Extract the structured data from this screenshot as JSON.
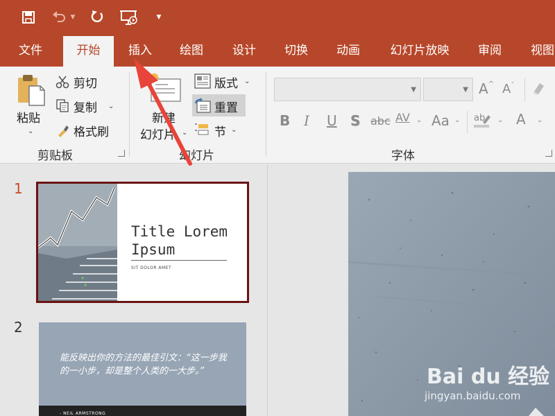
{
  "quick_access": {
    "icons": [
      "save-icon",
      "undo-icon",
      "dropdown-icon",
      "redo-icon",
      "slideshow-icon",
      "customize-icon"
    ]
  },
  "tabs": [
    {
      "label": "文件",
      "active": false
    },
    {
      "label": "开始",
      "active": true
    },
    {
      "label": "插入",
      "active": false
    },
    {
      "label": "绘图",
      "active": false
    },
    {
      "label": "设计",
      "active": false
    },
    {
      "label": "切换",
      "active": false
    },
    {
      "label": "动画",
      "active": false
    },
    {
      "label": "幻灯片放映",
      "active": false
    },
    {
      "label": "审阅",
      "active": false
    },
    {
      "label": "视图",
      "active": false
    }
  ],
  "ribbon": {
    "clipboard": {
      "paste": "粘贴",
      "cut": "剪切",
      "copy": "复制",
      "format_painter": "格式刷",
      "group_label": "剪贴板"
    },
    "slides": {
      "new_slide_line1": "新建",
      "new_slide_line2": "幻灯片",
      "layout": "版式",
      "reset": "重置",
      "section": "节",
      "group_label": "幻灯片"
    },
    "font": {
      "font_name": "",
      "font_size": "",
      "bold": "B",
      "italic": "I",
      "underline": "U",
      "shadow": "S",
      "strikethrough": "abc",
      "spacing": "AV",
      "change_case": "Aa",
      "font_color": "A",
      "grow": "A",
      "shrink": "A",
      "group_label": "字体"
    }
  },
  "slides": [
    {
      "number": "1",
      "title": "Title Lorem Ipsum",
      "subtitle": "SIT DOLOR AMET",
      "selected": true
    },
    {
      "number": "2",
      "quote": "能反映出你的方法的最佳引文：“这一步我的一小步，却是整个人类的一大步。”",
      "author": "- NEIL ARMSTRONG"
    }
  ],
  "watermark": {
    "logo": "Bai du 经验",
    "url": "jingyan.baidu.com"
  },
  "colors": {
    "accent": "#b7472a",
    "ribbon_bg": "#f3f3f3",
    "workspace_bg": "#e6e6e6",
    "selection_border": "#6b1212",
    "slide_number_active": "#c44a25",
    "arrow": "#e8443a"
  }
}
